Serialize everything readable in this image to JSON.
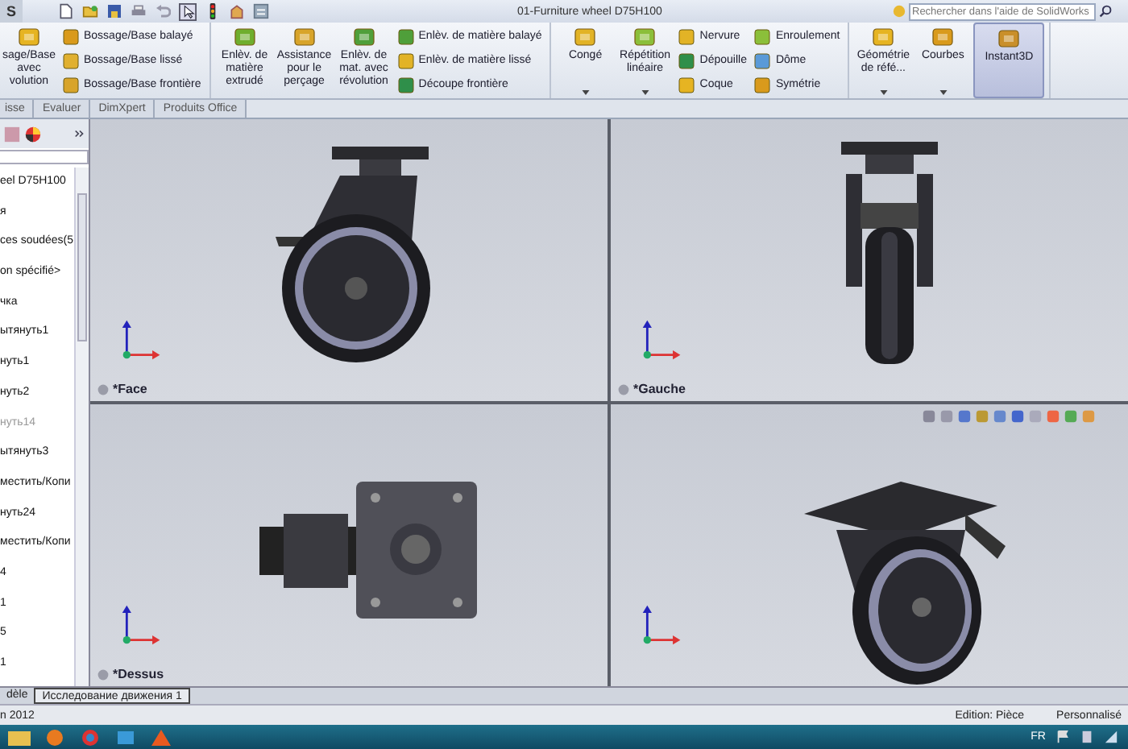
{
  "window": {
    "app_menu": "S",
    "title": "01-Furniture wheel D75H100"
  },
  "search": {
    "placeholder": "Rechercher dans l'aide de SolidWorks"
  },
  "ribbon": {
    "groups": [
      {
        "columns": [
          {
            "kind": "large",
            "label": "sage/Base avec volution",
            "dropdown": false,
            "on": false
          },
          {
            "kind": "stack",
            "items": [
              {
                "label": "Bossage/Base balayé"
              },
              {
                "label": "Bossage/Base lissé"
              },
              {
                "label": "Bossage/Base frontière"
              }
            ]
          }
        ]
      },
      {
        "columns": [
          {
            "kind": "large",
            "label": "Enlèv. de matière extrudé",
            "dropdown": false,
            "on": false
          },
          {
            "kind": "large",
            "label": "Assistance pour le perçage",
            "dropdown": false,
            "on": false
          },
          {
            "kind": "large",
            "label": "Enlèv. de mat. avec révolution",
            "dropdown": false,
            "on": false
          },
          {
            "kind": "stack",
            "items": [
              {
                "label": "Enlèv. de matière balayé"
              },
              {
                "label": "Enlèv. de matière lissé"
              },
              {
                "label": "Découpe frontière"
              }
            ]
          }
        ]
      },
      {
        "columns": [
          {
            "kind": "large",
            "label": "Congé",
            "dropdown": true,
            "on": false
          },
          {
            "kind": "large",
            "label": "Répétition linéaire",
            "dropdown": true,
            "on": false
          },
          {
            "kind": "stack",
            "items": [
              {
                "label": "Nervure"
              },
              {
                "label": "Dépouille"
              },
              {
                "label": "Coque"
              }
            ]
          },
          {
            "kind": "stack",
            "items": [
              {
                "label": "Enroulement"
              },
              {
                "label": "Dôme"
              },
              {
                "label": "Symétrie"
              }
            ]
          }
        ]
      },
      {
        "columns": [
          {
            "kind": "large",
            "label": "Géométrie de réfé...",
            "dropdown": true,
            "on": false
          },
          {
            "kind": "large",
            "label": "Courbes",
            "dropdown": true,
            "on": false
          },
          {
            "kind": "large",
            "label": "Instant3D",
            "dropdown": false,
            "on": true
          }
        ]
      }
    ]
  },
  "command_tabs": [
    {
      "label": "isse",
      "selected": false
    },
    {
      "label": "Evaluer",
      "selected": false
    },
    {
      "label": "DimXpert",
      "selected": false
    },
    {
      "label": "Produits Office",
      "selected": false
    }
  ],
  "feature_tree": {
    "items": [
      {
        "label": "eel D75H100",
        "disabled": false
      },
      {
        "label": "я",
        "disabled": false
      },
      {
        "label": "ces soudées(5",
        "disabled": false
      },
      {
        "label": "on spécifié>",
        "disabled": false
      },
      {
        "label": "чка",
        "disabled": false
      },
      {
        "label": "ытянуть1",
        "disabled": false
      },
      {
        "label": "нуть1",
        "disabled": false
      },
      {
        "label": "нуть2",
        "disabled": false
      },
      {
        "label": "нуть14",
        "disabled": true
      },
      {
        "label": "ытянуть3",
        "disabled": false
      },
      {
        "label": "местить/Копи",
        "disabled": false
      },
      {
        "label": "нуть24",
        "disabled": false
      },
      {
        "label": "местить/Копи",
        "disabled": false
      },
      {
        "label": "4",
        "disabled": false
      },
      {
        "label": "1",
        "disabled": false
      },
      {
        "label": "5",
        "disabled": false
      },
      {
        "label": "1",
        "disabled": false
      }
    ]
  },
  "viewports": [
    {
      "kind": "side",
      "label": "*Face",
      "toolbar": false
    },
    {
      "kind": "front",
      "label": "*Gauche",
      "toolbar": false
    },
    {
      "kind": "top",
      "label": "*Dessus",
      "toolbar": false
    },
    {
      "kind": "iso",
      "toolbar": true
    }
  ],
  "bottom_tabs": [
    {
      "label": "dèle",
      "selected": false
    },
    {
      "label": "Исследование движения 1",
      "selected": true
    }
  ],
  "status_bar": {
    "version": "n 2012",
    "mode": "Edition: Pièce",
    "units": "Personnalisé"
  },
  "taskbar": {
    "language": "FR"
  }
}
